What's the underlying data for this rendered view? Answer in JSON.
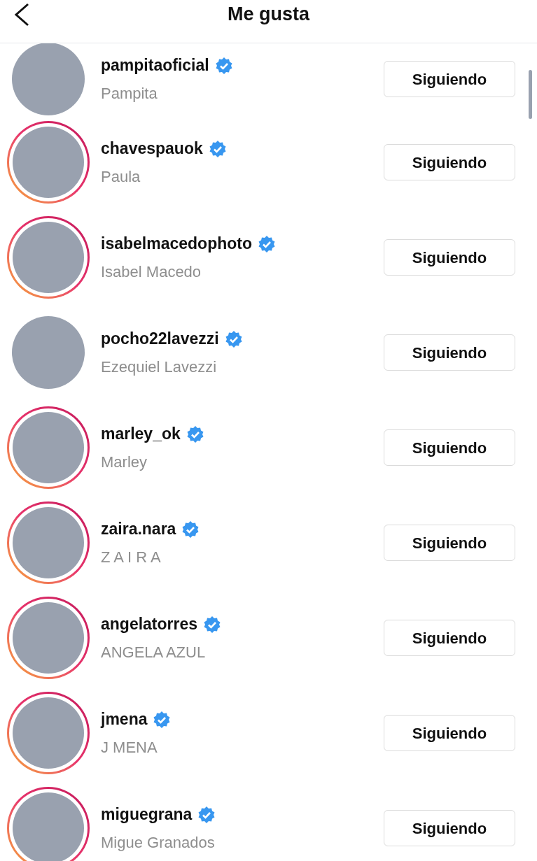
{
  "header": {
    "title": "Me gusta"
  },
  "accounts": [
    {
      "username": "pampitaoficial",
      "name": "Pampita",
      "verified": true,
      "story_ring": false,
      "button": "Siguiendo"
    },
    {
      "username": "chavespauok",
      "name": "Paula",
      "verified": true,
      "story_ring": true,
      "button": "Siguiendo"
    },
    {
      "username": "isabelmacedophoto",
      "name": "Isabel Macedo",
      "verified": true,
      "story_ring": true,
      "button": "Siguiendo"
    },
    {
      "username": "pocho22lavezzi",
      "name": "Ezequiel Lavezzi",
      "verified": true,
      "story_ring": false,
      "button": "Siguiendo"
    },
    {
      "username": "marley_ok",
      "name": "Marley",
      "verified": true,
      "story_ring": true,
      "button": "Siguiendo"
    },
    {
      "username": "zaira.nara",
      "name": "Z A I R A",
      "verified": true,
      "story_ring": true,
      "button": "Siguiendo"
    },
    {
      "username": "angelatorres",
      "name": "ANGELA AZUL",
      "verified": true,
      "story_ring": true,
      "button": "Siguiendo"
    },
    {
      "username": "jmena",
      "name": "J MENA",
      "verified": true,
      "story_ring": true,
      "button": "Siguiendo"
    },
    {
      "username": "miguegrana",
      "name": "Migue Granados",
      "verified": true,
      "story_ring": true,
      "button": "Siguiendo"
    }
  ]
}
